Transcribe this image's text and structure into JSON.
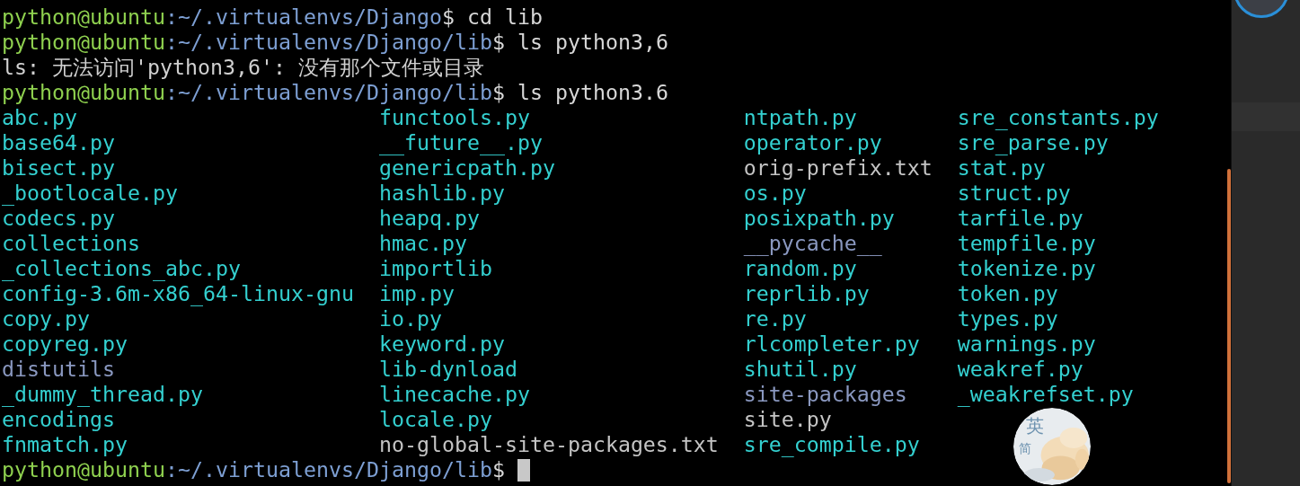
{
  "terminal": {
    "lines": [
      {
        "kind": "prompt",
        "user": "python@ubuntu",
        "path": ":~/.virtualenvs/Django",
        "symbol": "$",
        "command": "cd lib"
      },
      {
        "kind": "prompt",
        "user": "python@ubuntu",
        "path": ":~/.virtualenvs/Django/lib",
        "symbol": "$",
        "command": "ls python3,6"
      },
      {
        "kind": "output",
        "text": "ls: 无法访问'python3,6': 没有那个文件或目录"
      },
      {
        "kind": "prompt",
        "user": "python@ubuntu",
        "path": ":~/.virtualenvs/Django/lib",
        "symbol": "$",
        "command": "ls python3.6"
      }
    ],
    "listing": {
      "columns": [
        [
          {
            "name": "abc.py",
            "color": "#34d0d0"
          },
          {
            "name": "base64.py",
            "color": "#34d0d0"
          },
          {
            "name": "bisect.py",
            "color": "#34d0d0"
          },
          {
            "name": "_bootlocale.py",
            "color": "#34d0d0"
          },
          {
            "name": "codecs.py",
            "color": "#34d0d0"
          },
          {
            "name": "collections",
            "color": "#34d0d0"
          },
          {
            "name": "_collections_abc.py",
            "color": "#34d0d0"
          },
          {
            "name": "config-3.6m-x86_64-linux-gnu",
            "color": "#34d0d0"
          },
          {
            "name": "copy.py",
            "color": "#34d0d0"
          },
          {
            "name": "copyreg.py",
            "color": "#34d0d0"
          },
          {
            "name": "distutils",
            "color": "#8a98c0"
          },
          {
            "name": "_dummy_thread.py",
            "color": "#34d0d0"
          },
          {
            "name": "encodings",
            "color": "#34d0d0"
          },
          {
            "name": "fnmatch.py",
            "color": "#34d0d0"
          }
        ],
        [
          {
            "name": "functools.py",
            "color": "#34d0d0"
          },
          {
            "name": "__future__.py",
            "color": "#34d0d0"
          },
          {
            "name": "genericpath.py",
            "color": "#34d0d0"
          },
          {
            "name": "hashlib.py",
            "color": "#34d0d0"
          },
          {
            "name": "heapq.py",
            "color": "#34d0d0"
          },
          {
            "name": "hmac.py",
            "color": "#34d0d0"
          },
          {
            "name": "importlib",
            "color": "#34d0d0"
          },
          {
            "name": "imp.py",
            "color": "#34d0d0"
          },
          {
            "name": "io.py",
            "color": "#34d0d0"
          },
          {
            "name": "keyword.py",
            "color": "#34d0d0"
          },
          {
            "name": "lib-dynload",
            "color": "#34d0d0"
          },
          {
            "name": "linecache.py",
            "color": "#34d0d0"
          },
          {
            "name": "locale.py",
            "color": "#34d0d0"
          },
          {
            "name": "no-global-site-packages.txt",
            "color": "#c4c4c4"
          }
        ],
        [
          {
            "name": "ntpath.py",
            "color": "#34d0d0"
          },
          {
            "name": "operator.py",
            "color": "#34d0d0"
          },
          {
            "name": "orig-prefix.txt",
            "color": "#c4c4c4"
          },
          {
            "name": "os.py",
            "color": "#34d0d0"
          },
          {
            "name": "posixpath.py",
            "color": "#34d0d0"
          },
          {
            "name": "__pycache__",
            "color": "#8a98c0"
          },
          {
            "name": "random.py",
            "color": "#34d0d0"
          },
          {
            "name": "reprlib.py",
            "color": "#34d0d0"
          },
          {
            "name": "re.py",
            "color": "#34d0d0"
          },
          {
            "name": "rlcompleter.py",
            "color": "#34d0d0"
          },
          {
            "name": "shutil.py",
            "color": "#34d0d0"
          },
          {
            "name": "site-packages",
            "color": "#8a98c0"
          },
          {
            "name": "site.py",
            "color": "#c4c4c4"
          },
          {
            "name": "sre_compile.py",
            "color": "#34d0d0"
          }
        ],
        [
          {
            "name": "sre_constants.py",
            "color": "#34d0d0"
          },
          {
            "name": "sre_parse.py",
            "color": "#34d0d0"
          },
          {
            "name": "stat.py",
            "color": "#34d0d0"
          },
          {
            "name": "struct.py",
            "color": "#34d0d0"
          },
          {
            "name": "tarfile.py",
            "color": "#34d0d0"
          },
          {
            "name": "tempfile.py",
            "color": "#34d0d0"
          },
          {
            "name": "tokenize.py",
            "color": "#34d0d0"
          },
          {
            "name": "token.py",
            "color": "#34d0d0"
          },
          {
            "name": "types.py",
            "color": "#34d0d0"
          },
          {
            "name": "warnings.py",
            "color": "#34d0d0"
          },
          {
            "name": "weakref.py",
            "color": "#34d0d0"
          },
          {
            "name": "_weakrefset.py",
            "color": "#34d0d0"
          }
        ]
      ]
    },
    "final_prompt": {
      "user": "python@ubuntu",
      "path": ":~/.virtualenvs/Django/lib",
      "symbol": "$"
    }
  },
  "ime_indicator": {
    "mode": "英",
    "charset": "简"
  }
}
